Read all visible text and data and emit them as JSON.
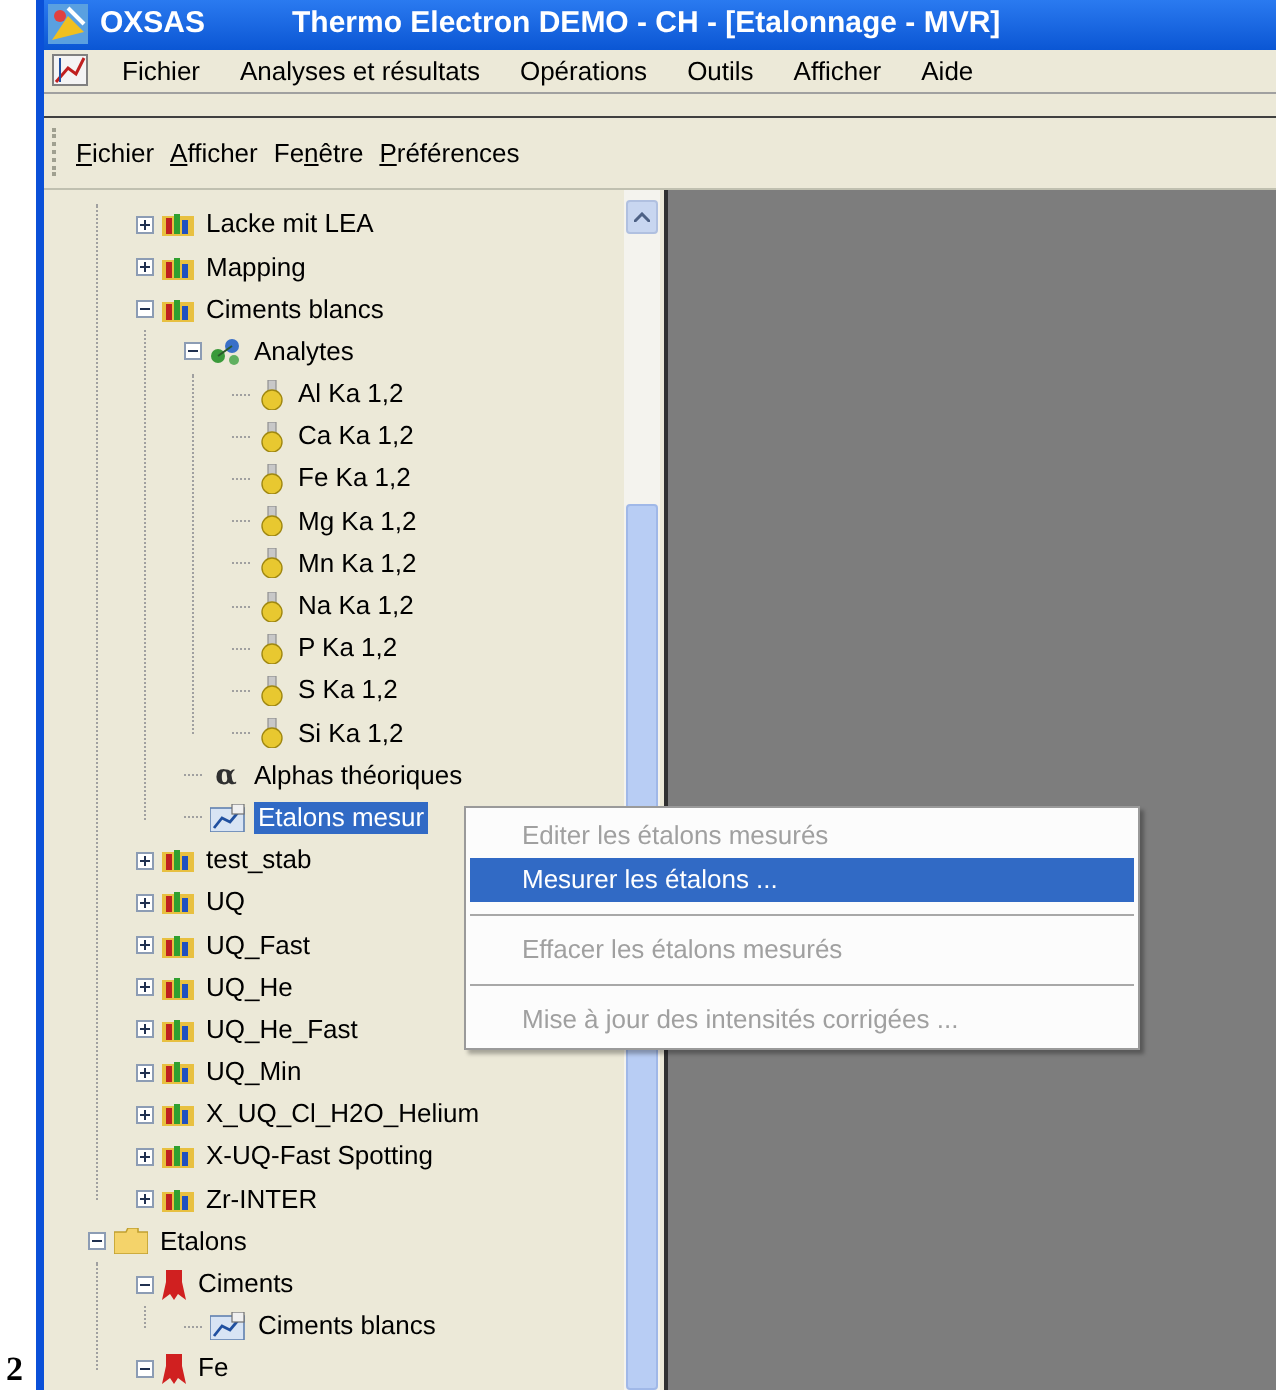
{
  "figure_label": "2",
  "window": {
    "app_name": "OXSAS",
    "title": "Thermo Electron DEMO - CH - [Etalonnage - MVR]"
  },
  "menu_bar": [
    "Fichier",
    "Analyses et résultats",
    "Opérations",
    "Outils",
    "Afficher",
    "Aide"
  ],
  "toolbar_menu": [
    {
      "key": "F",
      "after": "ichier"
    },
    {
      "key": "A",
      "after": "fficher"
    },
    {
      "before": "Fe",
      "key": "n",
      "after": "être"
    },
    {
      "key": "P",
      "after": "références"
    }
  ],
  "tree": [
    {
      "kind": "continuation",
      "children": [
        {
          "label": "Lacke mit LEA",
          "kind": "chart-folder",
          "expanded": false,
          "selected": false
        },
        {
          "label": "Mapping",
          "kind": "chart-folder",
          "expanded": false,
          "selected": false
        },
        {
          "label": "Ciments blancs",
          "kind": "chart-folder",
          "expanded": true,
          "selected": false,
          "children": [
            {
              "label": "Analytes",
              "kind": "analytes",
              "expanded": true,
              "selected": false,
              "children": [
                {
                  "label": "Al Ka 1,2",
                  "kind": "flask",
                  "selected": false
                },
                {
                  "label": "Ca Ka 1,2",
                  "kind": "flask",
                  "selected": false
                },
                {
                  "label": "Fe Ka 1,2",
                  "kind": "flask",
                  "selected": false
                },
                {
                  "label": "Mg Ka 1,2",
                  "kind": "flask",
                  "selected": false
                },
                {
                  "label": "Mn Ka 1,2",
                  "kind": "flask",
                  "selected": false
                },
                {
                  "label": "Na Ka 1,2",
                  "kind": "flask",
                  "selected": false
                },
                {
                  "label": "P Ka 1,2",
                  "kind": "flask",
                  "selected": false
                },
                {
                  "label": "S Ka 1,2",
                  "kind": "flask",
                  "selected": false
                },
                {
                  "label": "Si Ka 1,2",
                  "kind": "flask",
                  "selected": false
                }
              ]
            },
            {
              "label": "Alphas théoriques",
              "kind": "alpha",
              "glyph": "α",
              "selected": false
            },
            {
              "label": "Etalons mesur",
              "kind": "measured",
              "selected": true
            }
          ]
        },
        {
          "label": "test_stab",
          "kind": "chart-folder",
          "expanded": false,
          "selected": false
        },
        {
          "label": "UQ",
          "kind": "chart-folder",
          "expanded": false,
          "selected": false
        },
        {
          "label": "UQ_Fast",
          "kind": "chart-folder",
          "expanded": false,
          "selected": false
        },
        {
          "label": "UQ_He",
          "kind": "chart-folder",
          "expanded": false,
          "selected": false
        },
        {
          "label": "UQ_He_Fast",
          "kind": "chart-folder",
          "expanded": false,
          "selected": false
        },
        {
          "label": "UQ_Min",
          "kind": "chart-folder",
          "expanded": false,
          "selected": false
        },
        {
          "label": "X_UQ_Cl_H2O_Helium",
          "kind": "chart-folder",
          "expanded": false,
          "selected": false
        },
        {
          "label": "X-UQ-Fast Spotting",
          "kind": "chart-folder",
          "expanded": false,
          "selected": false
        },
        {
          "label": "Zr-INTER",
          "kind": "chart-folder",
          "expanded": false,
          "selected": false
        }
      ]
    },
    {
      "label": "Etalons",
      "kind": "folder",
      "expanded": true,
      "selected": false,
      "children": [
        {
          "label": "Ciments",
          "kind": "ribbon",
          "expanded": true,
          "selected": false,
          "children": [
            {
              "label": "Ciments blancs",
              "kind": "measured",
              "selected": false
            }
          ]
        },
        {
          "label": "Fe",
          "kind": "ribbon",
          "expanded": true,
          "selected": false
        }
      ]
    }
  ],
  "context_menu": [
    {
      "kind": "item",
      "label": "Editer les étalons mesurés",
      "disabled": true,
      "selected": false
    },
    {
      "kind": "item",
      "label": "Mesurer les étalons ...",
      "disabled": false,
      "selected": true
    },
    {
      "kind": "separator"
    },
    {
      "kind": "item",
      "label": "Effacer les étalons mesurés",
      "disabled": true,
      "selected": false
    },
    {
      "kind": "separator"
    },
    {
      "kind": "item",
      "label": "Mise à jour des intensités corrigées ...",
      "disabled": true,
      "selected": false
    }
  ]
}
